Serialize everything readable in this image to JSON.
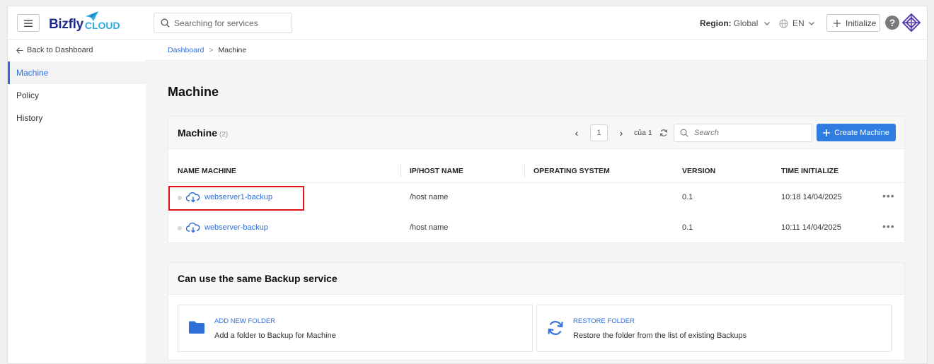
{
  "header": {
    "logo_main": "Bizfly",
    "logo_sub": "CLOUD",
    "search_placeholder": "Searching for services",
    "region_label": "Region:",
    "region_value": "Global",
    "language": "EN",
    "initialize_label": "Initialize",
    "help_label": "?"
  },
  "sidebar": {
    "back_label": "Back to Dashboard",
    "items": [
      {
        "label": "Machine",
        "active": true
      },
      {
        "label": "Policy",
        "active": false
      },
      {
        "label": "History",
        "active": false
      }
    ]
  },
  "breadcrumb": {
    "root": "Dashboard",
    "separator": ">",
    "current": "Machine"
  },
  "page": {
    "title": "Machine"
  },
  "machines_card": {
    "title": "Machine",
    "count": "(2)",
    "pager": {
      "prev": "‹",
      "page": "1",
      "next": "›",
      "of_label": "của 1"
    },
    "search_placeholder": "Search",
    "create_label": "Create Machine",
    "columns": [
      "NAME MACHINE",
      "IP/HOST NAME",
      "OPERATING SYSTEM",
      "VERSION",
      "TIME INITIALIZE"
    ],
    "rows": [
      {
        "name": "webserver1-backup",
        "host": "/host name",
        "os": "",
        "version": "0.1",
        "time": "10:18 14/04/2025",
        "more": "•••"
      },
      {
        "name": "webserver-backup",
        "host": "/host name",
        "os": "",
        "version": "0.1",
        "time": "10:11 14/04/2025",
        "more": "•••"
      }
    ]
  },
  "services_card": {
    "title": "Can use the same Backup service",
    "tiles": [
      {
        "title": "ADD NEW FOLDER",
        "desc": "Add a folder to Backup for Machine",
        "icon": "folder-icon"
      },
      {
        "title": "RESTORE FOLDER",
        "desc": "Restore the folder from the list of existing Backups",
        "icon": "restore-icon"
      }
    ]
  },
  "colors": {
    "accent": "#2f6fd8",
    "button": "#2f7de1",
    "highlight": "#e0131b",
    "brand_dark": "#1e2a8a",
    "brand_light": "#2ea8e0"
  }
}
